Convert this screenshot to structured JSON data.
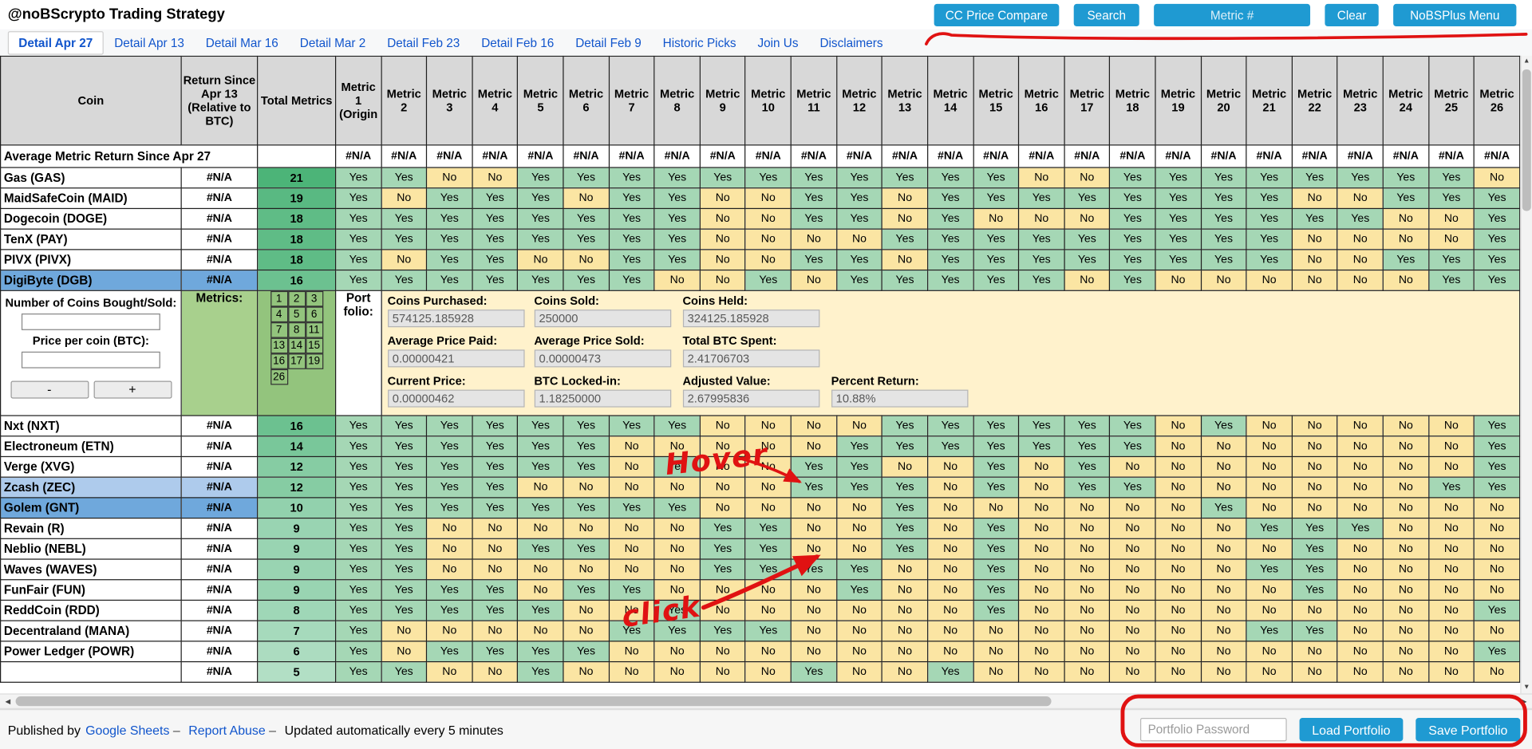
{
  "header": {
    "title": "@noBScrypto Trading Strategy",
    "cc_button": "CC Price Compare",
    "search_button": "Search",
    "metric_placeholder": "Metric #",
    "clear_button": "Clear",
    "menu_button": "NoBSPlus Menu"
  },
  "tabs": {
    "active_index": 0,
    "items": [
      "Detail Apr 27",
      "Detail Apr 13",
      "Detail Mar 16",
      "Detail Mar 2",
      "Detail Feb 23",
      "Detail Feb 16",
      "Detail Feb 9",
      "Historic Picks",
      "Join Us",
      "Disclaimers"
    ]
  },
  "table": {
    "headers": {
      "coin": "Coin",
      "ret": "Return Since Apr 13 (Relative to BTC)",
      "total": "Total Metrics"
    },
    "metric_headers": [
      "Metric 1 (Origin",
      "Metric 2",
      "Metric 3",
      "Metric 4",
      "Metric 5",
      "Metric 6",
      "Metric 7",
      "Metric 8",
      "Metric 9",
      "Metric 10",
      "Metric 11",
      "Metric 12",
      "Metric 13",
      "Metric 14",
      "Metric 15",
      "Metric 16",
      "Metric 17",
      "Metric 18",
      "Metric 19",
      "Metric 20",
      "Metric 21",
      "Metric 22",
      "Metric 23",
      "Metric 24",
      "Metric 25",
      "Metric 26"
    ],
    "yes_label": "Yes",
    "no_label": "No",
    "average_row": {
      "label": "Average Metric Return Since Apr 27",
      "value": "#N/A"
    },
    "rows": [
      {
        "coin": "Gas (GAS)",
        "ret": "#N/A",
        "total": 21,
        "hl": null,
        "m": "YYNNYYYYYYYYYYYNNYYYYYYYYN"
      },
      {
        "coin": "MaidSafeCoin (MAID)",
        "ret": "#N/A",
        "total": 19,
        "hl": null,
        "m": "YNYYYNYYNNYYNYYYYYYYYNNYYY"
      },
      {
        "coin": "Dogecoin (DOGE)",
        "ret": "#N/A",
        "total": 18,
        "hl": null,
        "m": "YYYYYYYYNNYYNYNNNYYYYYYNNY"
      },
      {
        "coin": "TenX (PAY)",
        "ret": "#N/A",
        "total": 18,
        "hl": null,
        "m": "YYYYYYYYNNNNYYYYYYYYYNNNNY"
      },
      {
        "coin": "PIVX (PIVX)",
        "ret": "#N/A",
        "total": 18,
        "hl": null,
        "m": "YNYYNNYYNNYYNYYYYYYYYNNYYY"
      },
      {
        "coin": "DigiByte (DGB)",
        "ret": "#N/A",
        "total": 16,
        "hl": "strong",
        "m": "YYYYYYYNNYNYYYYYNYNNNNNNYY"
      },
      {
        "coin": "Nxt (NXT)",
        "ret": "#N/A",
        "total": 16,
        "hl": null,
        "m": "YYYYYYYYNNNNYYYYYYNYNNNNNY"
      },
      {
        "coin": "Electroneum (ETN)",
        "ret": "#N/A",
        "total": 14,
        "hl": null,
        "m": "YYYYYYNNNNNYYYYYYYNNNNNNNY"
      },
      {
        "coin": "Verge (XVG)",
        "ret": "#N/A",
        "total": 12,
        "hl": null,
        "m": "YYYYYYNYNNYYNNYNYNNNNNNNNY"
      },
      {
        "coin": "Zcash (ZEC)",
        "ret": "#N/A",
        "total": 12,
        "hl": "light",
        "m": "YYYYNNNNNNYYYNYNYYNNNNNNYY"
      },
      {
        "coin": "Golem (GNT)",
        "ret": "#N/A",
        "total": 10,
        "hl": "strong",
        "m": "YYYYYYYYNNNNYNNNNNNYNNNNNN"
      },
      {
        "coin": "Revain (R)",
        "ret": "#N/A",
        "total": 9,
        "hl": null,
        "m": "YYNNNNNNYYNNYNYNNNNNYYYNNN"
      },
      {
        "coin": "Neblio (NEBL)",
        "ret": "#N/A",
        "total": 9,
        "hl": null,
        "m": "YYNNYYNNYYNNYNYNNNNNNYNNNN"
      },
      {
        "coin": "Waves (WAVES)",
        "ret": "#N/A",
        "total": 9,
        "hl": null,
        "m": "YYNNNNNNYYYYNNYNNNNNYYNNNN"
      },
      {
        "coin": "FunFair (FUN)",
        "ret": "#N/A",
        "total": 9,
        "hl": null,
        "m": "YYYYNYYNNNNYNNYNNNNNNYNNNN"
      },
      {
        "coin": "ReddCoin (RDD)",
        "ret": "#N/A",
        "total": 8,
        "hl": null,
        "m": "YYYYYNNYNNNNNNYNNNNNNNNNNY"
      },
      {
        "coin": "Decentraland (MANA)",
        "ret": "#N/A",
        "total": 7,
        "hl": null,
        "m": "YNNNNNYYYYNNNNNNNNNNYYNNNN"
      },
      {
        "coin": "Power Ledger (POWR)",
        "ret": "#N/A",
        "total": 6,
        "hl": null,
        "m": "YNYYYYNNNNNNNNNNNNNNNNNNNY"
      }
    ],
    "clipped_row": {
      "coin": "",
      "ret": "#N/A",
      "total": 5,
      "hl": null,
      "m": "YYNNYNNNNNYNNYNNNNNNNNNNNN"
    }
  },
  "portfolio": {
    "coins_label": "Number of Coins Bought/Sold:",
    "price_label": "Price per coin (BTC):",
    "minus": "-",
    "plus": "+",
    "metrics_label": "Metrics:",
    "portfolio_label": "Port folio:",
    "metric_numbers": [
      "1",
      "2",
      "3",
      "4",
      "5",
      "6",
      "7",
      "8",
      "11",
      "13",
      "14",
      "15",
      "16",
      "17",
      "19",
      "26"
    ],
    "fields": [
      {
        "label": "Coins Purchased:",
        "value": "574125.185928",
        "col": 1,
        "row": 1
      },
      {
        "label": "Coins Sold:",
        "value": "250000",
        "col": 2,
        "row": 1
      },
      {
        "label": "Coins Held:",
        "value": "324125.185928",
        "col": 3,
        "row": 1
      },
      {
        "label": "Average Price Paid:",
        "value": "0.00000421",
        "col": 1,
        "row": 2
      },
      {
        "label": "Average Price Sold:",
        "value": "0.00000473",
        "col": 2,
        "row": 2
      },
      {
        "label": "Total BTC Spent:",
        "value": "2.41706703",
        "col": 3,
        "row": 2
      },
      {
        "label": "Current Price:",
        "value": "0.00000462",
        "col": 1,
        "row": 3
      },
      {
        "label": "BTC Locked-in:",
        "value": "1.18250000",
        "col": 2,
        "row": 3
      },
      {
        "label": "Adjusted Value:",
        "value": "2.67995836",
        "col": 3,
        "row": 3
      },
      {
        "label": "Percent Return:",
        "value": "10.88%",
        "col": 4,
        "row": 3
      }
    ]
  },
  "footer": {
    "published_by": "Published by",
    "google_sheets": "Google Sheets",
    "dash": "–",
    "report_abuse": "Report Abuse",
    "updated": "Updated automatically every 5 minutes",
    "password_placeholder": "Portfolio Password",
    "load_button": "Load Portfolio",
    "save_button": "Save Portfolio"
  },
  "annotations": {
    "hover_text": "Hover",
    "click_text": "click"
  },
  "colors": {
    "button_blue": "#1f9ad2",
    "link_blue": "#1155cc",
    "yes_green": "#a5d7b5",
    "no_tan": "#fbe5a3",
    "total_green_base": "#4cb478",
    "row_highlight_strong": "#6fa8dc",
    "row_highlight_light": "#aecbec",
    "header_gray": "#d8d8d8",
    "portfolio_yellow": "#fff2cc",
    "metrics_grid_green": "#93c47d",
    "metrics_label_green": "#a8d08d",
    "annotation_red": "#e01212"
  }
}
